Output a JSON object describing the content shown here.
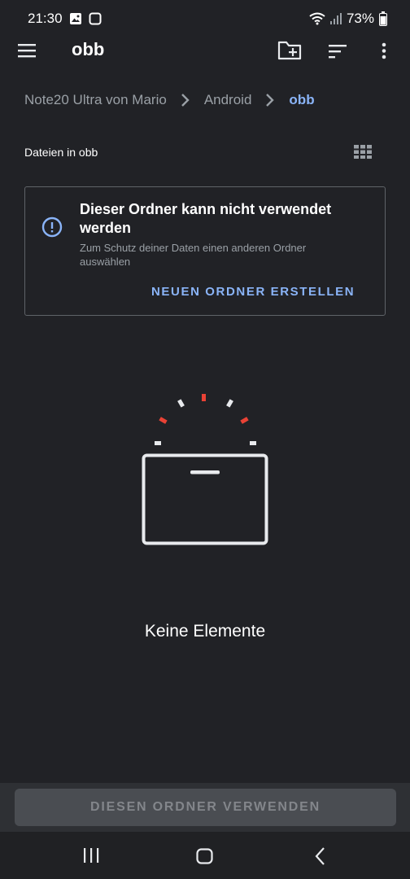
{
  "status_bar": {
    "time": "21:30",
    "battery_percent": "73%",
    "icons": [
      "image-icon",
      "screenshot-icon",
      "wifi-icon",
      "signal-icon",
      "battery-icon"
    ]
  },
  "app_bar": {
    "title": "obb",
    "icons": [
      "hamburger-menu-icon",
      "new-folder-icon",
      "sort-icon",
      "more-vert-icon"
    ]
  },
  "breadcrumb": {
    "items": [
      "Note20 Ultra von Mario",
      "Android",
      "obb"
    ]
  },
  "files_label": "Dateien in obb",
  "warning": {
    "title": "Dieser Ordner kann nicht verwendet werden",
    "text": "Zum Schutz deiner Daten einen anderen Ordner auswählen",
    "action_label": "NEUEN ORDNER ERSTELLEN"
  },
  "empty_state": {
    "text": "Keine Elemente"
  },
  "bottom_action": {
    "label": "DIESEN ORDNER VERWENDEN"
  },
  "colors": {
    "background": "#212226",
    "accent": "#8ab4f8",
    "illustration_red": "#e94235",
    "disabled_button": "#4a4d52"
  }
}
